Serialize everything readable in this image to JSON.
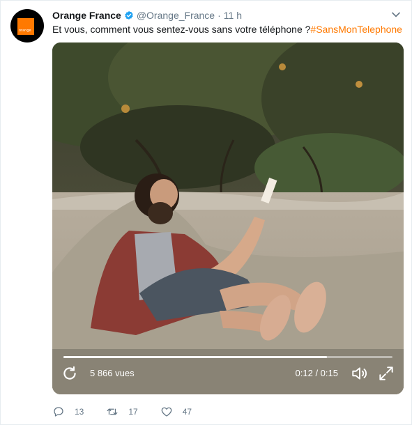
{
  "tweet": {
    "author_name": "Orange France",
    "handle": "@Orange_France",
    "separator": "·",
    "time": "11 h",
    "text": "Et vous, comment vous sentez-vous sans votre téléphone ?",
    "hashtag": "#SansMonTelephone",
    "avatar_logo_text": "orange",
    "brand_color": "#ff7900",
    "verified_color": "#1da1f2"
  },
  "video": {
    "views": "5 866 vues",
    "time_display": "0:12 / 0:15",
    "progress": 0.8
  },
  "actions": {
    "replies": "13",
    "retweets": "17",
    "likes": "47"
  }
}
